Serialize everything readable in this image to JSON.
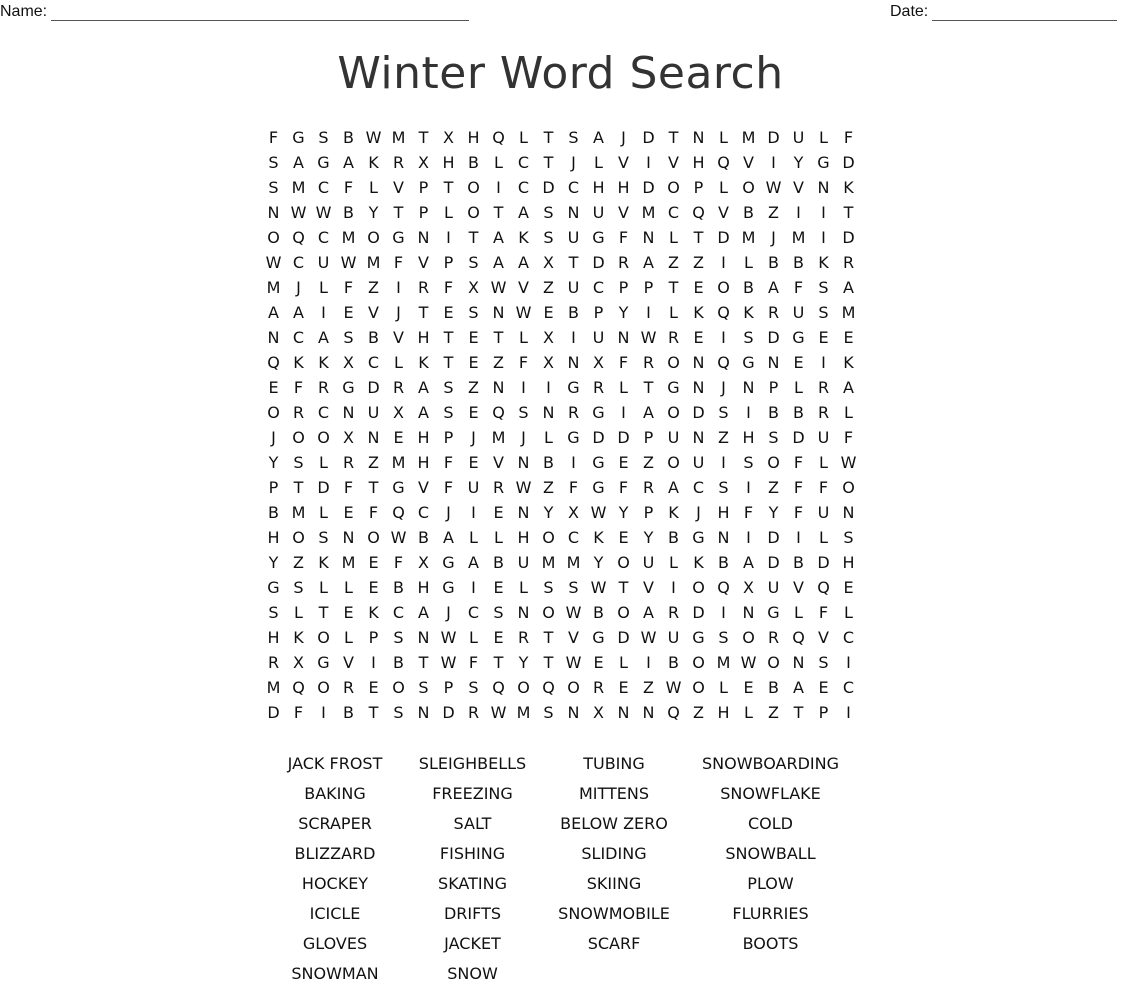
{
  "header": {
    "name_label": "Name:",
    "date_label": "Date:"
  },
  "title": "Winter Word Search",
  "grid": [
    "FGSBWMTXHQLTSAJDTNLMDULF",
    "SAGAKRXHBLCTJLVIVHQVIYGD",
    "SMCFLVPTOICDCHHDOPLOWVNK",
    "NWWBYTPLOTASNUVMCQVBZIIT",
    "OQCMOGNITAKSUGFNLTDMJMID",
    "WCUWMFVPSAAXTDRAZZILBBKR",
    "MJLFZIRFXWVZUCPPTEOBAFSA",
    "AAIEVJTESNWEBPYILKQKRUSM",
    "NCASBVHTETLXIUNWREISDGEE",
    "QKKXCLKTEZFXNXFRONQGNEIK",
    "EFRGDRASZNIIGRLTGNJNPLRA",
    "ORCNUXASEQSNRGIAODSIBBRL",
    "JOOXNEHPJMJLGDDPUNZHSDUF",
    "YSLRZMHFEVNBIGEZOUISOFLW",
    "PTDFTGVFURWZFGFRACSIZFFO",
    "BMLEFQCJIENYXWYPKJHFYFUN",
    "HOSNOWBALLHOCKEYBGNIDILS",
    "YZKMEFXGABUMMYOULKBADBDH",
    "GSLLEBHGIELSSWTVIOQXUVQE",
    "SLTEKCAJCSNOWBOARDINGLFL",
    "HKOLPSNWLERTVGDWUGSORQVC",
    "RXGVIBTWFTYTWELIBOMWONSI",
    "MQOREOSPSQOQOREZWOLEBAEC",
    "DFIBTSNDRWMSNXNNQZHLZTPI"
  ],
  "word_list": [
    "JACK FROST",
    "SLEIGHBELLS",
    "TUBING",
    "SNOWBOARDING",
    "BAKING",
    "FREEZING",
    "MITTENS",
    "SNOWFLAKE",
    "SCRAPER",
    "SALT",
    "BELOW ZERO",
    "COLD",
    "BLIZZARD",
    "FISHING",
    "SLIDING",
    "SNOWBALL",
    "HOCKEY",
    "SKATING",
    "SKIING",
    "PLOW",
    "ICICLE",
    "DRIFTS",
    "SNOWMOBILE",
    "FLURRIES",
    "GLOVES",
    "JACKET",
    "SCARF",
    "BOOTS",
    "SNOWMAN",
    "SNOW"
  ]
}
